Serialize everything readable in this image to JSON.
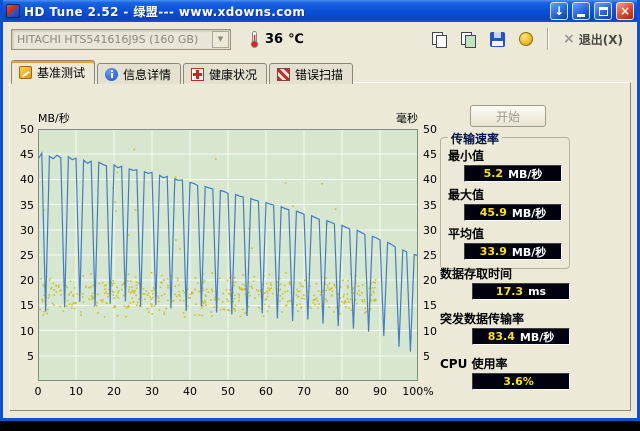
{
  "window": {
    "title": "HD Tune 2.52 - 绿盟--- www.xdowns.com",
    "icons": {
      "download_glyph": "↓",
      "close_glyph": "×"
    }
  },
  "toolbar": {
    "drive_select": "HITACHI HTS541616J9S (160 GB)",
    "dropdown_glyph": "▼",
    "temperature_value": "36",
    "temperature_unit": "℃",
    "exit_icon_glyph": "×",
    "exit_label": "退出(X)"
  },
  "tabs": [
    {
      "label": "基准测试"
    },
    {
      "label": "信息详情"
    },
    {
      "label": "健康状况"
    },
    {
      "label": "错误扫描"
    }
  ],
  "panel": {
    "start_button": "开始",
    "group_title": "传输速率",
    "stats": [
      {
        "label": "最小值",
        "value": "5.2",
        "unit": "MB/秒"
      },
      {
        "label": "最大值",
        "value": "45.9",
        "unit": "MB/秒"
      },
      {
        "label": "平均值",
        "value": "33.9",
        "unit": "MB/秒"
      }
    ],
    "extra_stats": [
      {
        "label": "数据存取时间",
        "value": "17.3",
        "unit": "ms"
      },
      {
        "label": "突发数据传输率",
        "value": "83.4",
        "unit": "MB/秒"
      },
      {
        "label": "CPU 使用率",
        "value": "3.6%",
        "unit": ""
      }
    ]
  },
  "chart_data": {
    "type": "line+scatter",
    "ylabel_left": "MB/秒",
    "ylabel_right": "毫秒",
    "xlim": [
      0,
      100
    ],
    "ylim": [
      0,
      50
    ],
    "x_ticks": [
      0,
      10,
      20,
      30,
      40,
      50,
      60,
      70,
      80,
      90,
      100
    ],
    "x_tick_labels": [
      "0",
      "10",
      "20",
      "30",
      "40",
      "50",
      "60",
      "70",
      "80",
      "90",
      "100%"
    ],
    "y_ticks": [
      50,
      45,
      40,
      35,
      30,
      25,
      20,
      15,
      10,
      5
    ],
    "plot_bg": "#d7e7cf",
    "grid_color": "#f6faf2",
    "series": [
      {
        "name": "transfer_rate_mb_s",
        "color": "#3f7dc9",
        "x_step": 1,
        "values": [
          44.0,
          45.2,
          13.8,
          44.6,
          44.1,
          44.8,
          44.3,
          14.6,
          44.5,
          43.9,
          44.2,
          15.7,
          43.8,
          43.2,
          43.6,
          14.9,
          43.4,
          43.0,
          42.7,
          15.3,
          42.9,
          42.3,
          42.6,
          15.8,
          42.1,
          41.8,
          41.9,
          14.7,
          41.5,
          41.2,
          41.4,
          15.1,
          40.8,
          40.3,
          40.6,
          14.4,
          40.1,
          39.8,
          39.9,
          13.9,
          39.4,
          39.2,
          38.8,
          14.8,
          38.6,
          38.3,
          38.1,
          13.6,
          37.8,
          37.6,
          37.2,
          13.2,
          37.0,
          36.7,
          36.5,
          12.9,
          36.2,
          35.9,
          35.7,
          13.4,
          35.4,
          35.1,
          34.9,
          12.4,
          34.6,
          34.2,
          34.0,
          11.9,
          33.7,
          33.4,
          33.1,
          12.2,
          32.8,
          32.4,
          32.1,
          11.4,
          31.8,
          31.5,
          31.2,
          10.9,
          30.9,
          30.5,
          30.2,
          10.4,
          29.9,
          29.5,
          29.1,
          9.8,
          28.7,
          28.4,
          28.0,
          8.9,
          27.5,
          27.1,
          26.6,
          6.8,
          26.0,
          25.6,
          5.8,
          25.1,
          24.9
        ]
      }
    ],
    "scatter": {
      "name": "access_time_dots",
      "color": "#d2bd2a",
      "seed": 42,
      "count": 550,
      "x_range": [
        0.5,
        89
      ],
      "y_mean": 17.0,
      "y_spread": 3.0,
      "y_range": [
        10.5,
        24.8
      ],
      "outlier_chance": 0.03,
      "outlier_y": [
        26,
        46
      ]
    }
  }
}
